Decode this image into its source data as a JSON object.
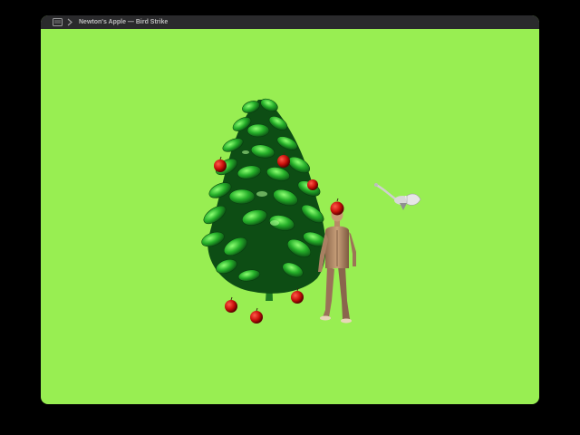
{
  "window": {
    "title": "Newton's Apple — Bird Strike"
  },
  "icons": {
    "menu": "window-menu-icon",
    "chevron": "chevron-right-icon"
  },
  "scene": {
    "background_color": "#98ee52",
    "objects": [
      "apple-tree",
      "apples",
      "person",
      "bird"
    ]
  }
}
